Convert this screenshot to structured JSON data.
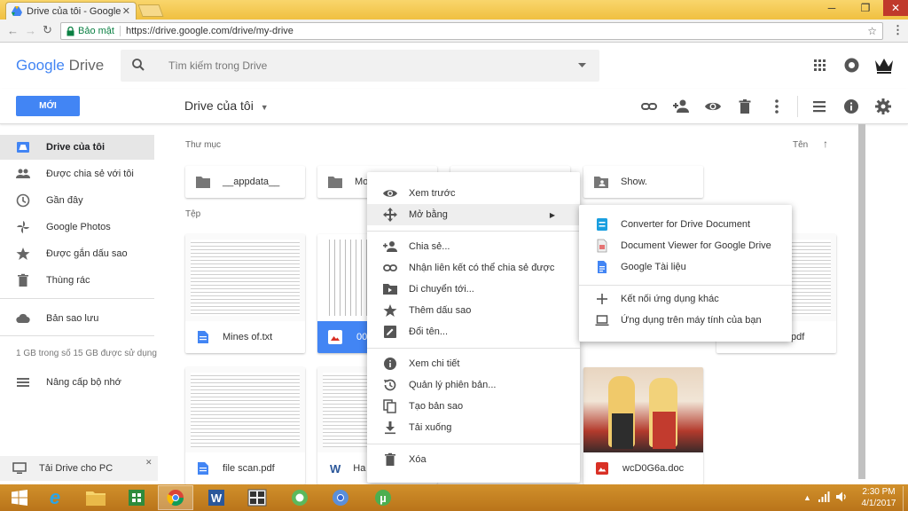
{
  "browser": {
    "tab_title": "Drive của tôi - Google D",
    "secure_label": "Bảo mật",
    "url": "https://drive.google.com/drive/my-drive"
  },
  "header": {
    "logo_google": "Google",
    "logo_drive": "Drive",
    "search_placeholder": "Tìm kiếm trong Drive"
  },
  "toolbar": {
    "new_label": "MỚI",
    "title": "Drive của tôi"
  },
  "sidebar": {
    "items": [
      {
        "label": "Drive của tôi"
      },
      {
        "label": "Được chia sẻ với tôi"
      },
      {
        "label": "Gần đây"
      },
      {
        "label": "Google Photos"
      },
      {
        "label": "Được gắn dấu sao"
      },
      {
        "label": "Thùng rác"
      },
      {
        "label": "Bản sao lưu"
      }
    ],
    "storage": "1 GB trong số 15 GB được sử dụng",
    "upgrade": "Nâng cấp bộ nhớ",
    "download_pc": "Tải Drive cho PC"
  },
  "main": {
    "folders_heading": "Thư mục",
    "files_heading": "Tệp",
    "sort_label": "Tên",
    "folders": [
      "__appdata__",
      "Mo",
      "Show."
    ],
    "files": [
      "Mines of.txt",
      "00",
      "pdf",
      "file scan.pdf",
      "Ha",
      "wcD0G6a.doc"
    ]
  },
  "context_menu": {
    "items": [
      "Xem trước",
      "Mở bằng",
      "Chia sẻ...",
      "Nhận liên kết có thể chia sẻ được",
      "Di chuyển tới...",
      "Thêm dấu sao",
      "Đổi tên...",
      "Xem chi tiết",
      "Quản lý phiên bản...",
      "Tạo bản sao",
      "Tải xuống",
      "Xóa"
    ]
  },
  "submenu": {
    "items": [
      "Converter for Drive Document",
      "Document Viewer for Google Drive",
      "Google Tài liệu",
      "Kết nối ứng dụng khác",
      "Ứng dụng trên máy tính của bạn"
    ]
  },
  "taskbar": {
    "time": "2:30 PM",
    "date": "4/1/2017"
  },
  "colors": {
    "accent": "#4285f4",
    "taskbar": "#c9831e"
  }
}
